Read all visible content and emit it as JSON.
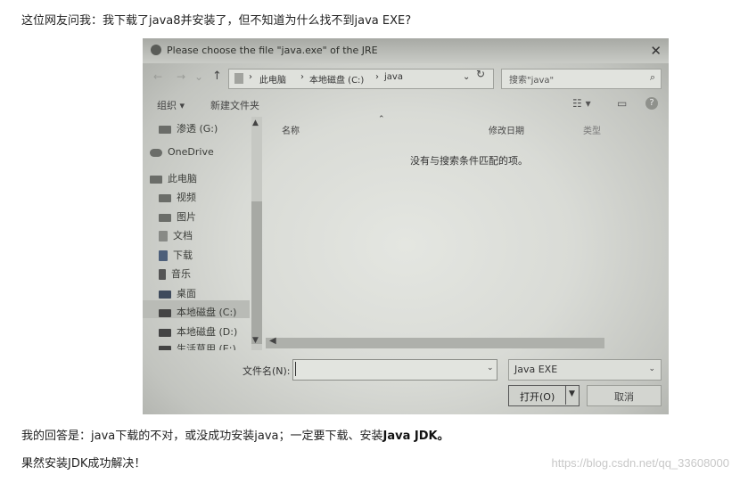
{
  "article": {
    "intro": "这位网友问我：我下载了java8并安装了，但不知道为什么找不到java EXE?",
    "answer_prefix": "我的回答是：java下载的不对，或没成功安装java；一定要下载、安装",
    "answer_bold": "Java JDK。",
    "conclusion": "果然安装JDK成功解决！",
    "watermark": "https://blog.csdn.net/qq_33608000"
  },
  "dialog": {
    "title": "Please choose the file \"java.exe\" of the JRE",
    "close_glyph": "✕",
    "address": {
      "segments": [
        "此电脑",
        "本地磁盘 (C:)",
        "java"
      ],
      "separator": "›"
    },
    "search_placeholder": "搜索\"java\"",
    "toolbar": {
      "organize": "组织 ▾",
      "new_folder": "新建文件夹",
      "view_glyph": "☷ ▾",
      "pane_glyph": "▭",
      "help_glyph": "?"
    },
    "sidebar": {
      "items": [
        "渗透 (G:)",
        "OneDrive",
        "此电脑",
        "视频",
        "图片",
        "文档",
        "下载",
        "音乐",
        "桌面",
        "本地磁盘 (C:)",
        "本地磁盘 (D:)",
        "生活草用 (E:)"
      ],
      "selected": "本地磁盘 (C:)"
    },
    "columns": [
      "名称",
      "修改日期",
      "类型"
    ],
    "empty_message": "没有与搜索条件匹配的项。",
    "filename_label": "文件名(N):",
    "filename_value": "",
    "filetype": "Java EXE",
    "open_label": "打开(O)",
    "cancel_label": "取消"
  }
}
